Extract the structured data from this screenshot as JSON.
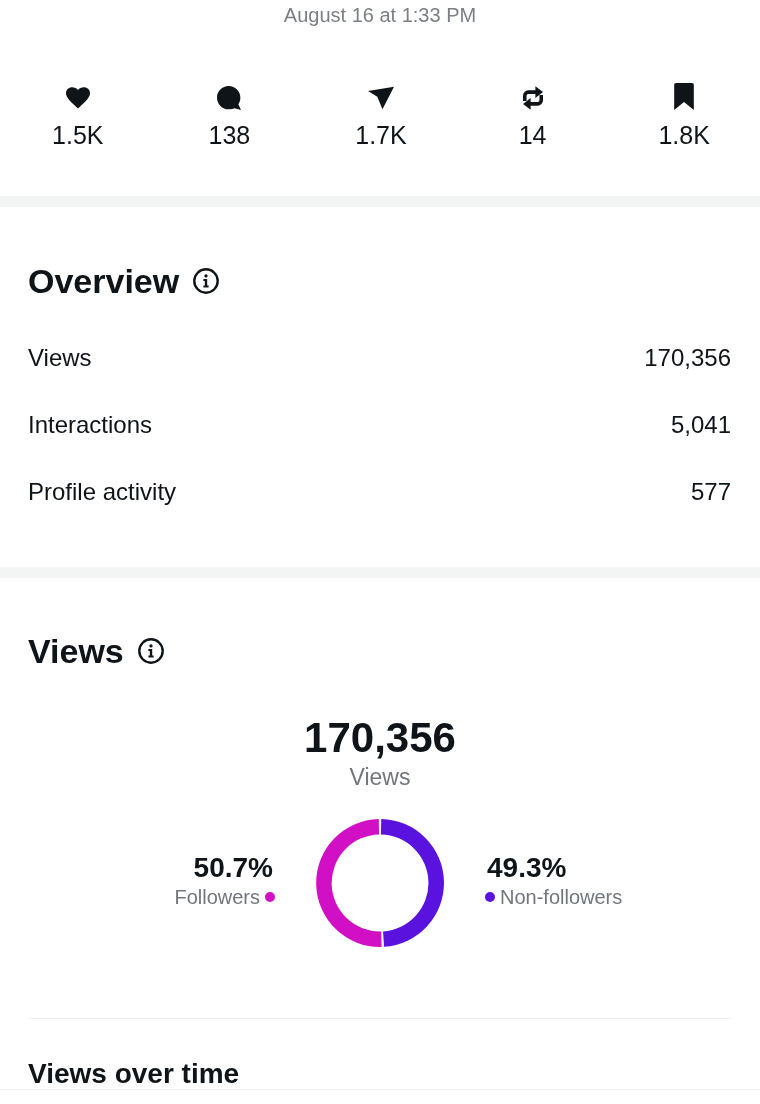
{
  "timestamp": "August 16 at 1:33 PM",
  "engagement": [
    {
      "count": "1.5K"
    },
    {
      "count": "138"
    },
    {
      "count": "1.7K"
    },
    {
      "count": "14"
    },
    {
      "count": "1.8K"
    }
  ],
  "overview": {
    "title": "Overview",
    "metrics": [
      {
        "label": "Views",
        "value": "170,356"
      },
      {
        "label": "Interactions",
        "value": "5,041"
      },
      {
        "label": "Profile activity",
        "value": "577"
      }
    ]
  },
  "views": {
    "title": "Views",
    "total": "170,356",
    "total_label": "Views",
    "legend": [
      {
        "value": "50.7%",
        "color": "#d10fc5"
      },
      {
        "value": "49.3%",
        "color": "#5a12de"
      }
    ],
    "chart_data": {
      "type": "donut",
      "categories": [
        "Followers",
        "Non-followers"
      ],
      "values": [
        50.7,
        49.3
      ]
    }
  },
  "views_over_time": {
    "title": "Views over time"
  }
}
